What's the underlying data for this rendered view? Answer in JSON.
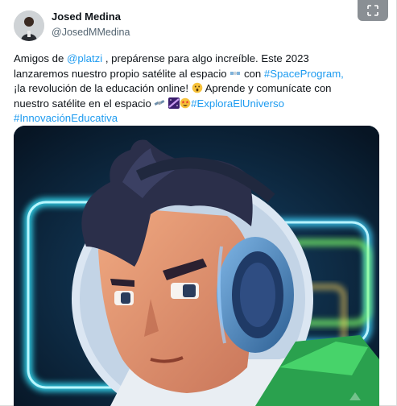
{
  "author": {
    "name": "Josed Medina",
    "handle": "@JosedMMedina"
  },
  "tweet": {
    "line1": {
      "pre": "Amigos de ",
      "mention": "@platzi",
      "post": " , prepárense para algo increíble. Este 2023"
    },
    "line2": {
      "pre": "lanzaremos nuestro propio satélite al espacio ",
      "mid": " con ",
      "hashtag": "#SpaceProgram,"
    },
    "line3": {
      "pre": "¡la revolución de la educación online! ",
      "post": " Aprende  y comunícate con"
    },
    "line4": {
      "pre": "nuestro satélite en el espacio ",
      "hashtag": "#ExploraElUniverso"
    },
    "line5": {
      "hashtag": "#InnovaciónEducativa"
    }
  },
  "icons": {
    "expand": "expand-icon",
    "emoji_satellite_1": "satellite-emoji-icon",
    "emoji_rocket_face": "astonished-face-emoji-icon",
    "emoji_satellite_2": "satellite-emoji-icon",
    "emoji_galaxy": "milky-way-emoji-icon",
    "emoji_starstruck": "star-struck-emoji-icon"
  },
  "colors": {
    "link": "#1d9bf0",
    "text": "#0f1419",
    "secondary": "#536471",
    "media_bg": "#0b1f33",
    "neon_cyan": "#35e6ff",
    "neon_green": "#7dff6a"
  }
}
